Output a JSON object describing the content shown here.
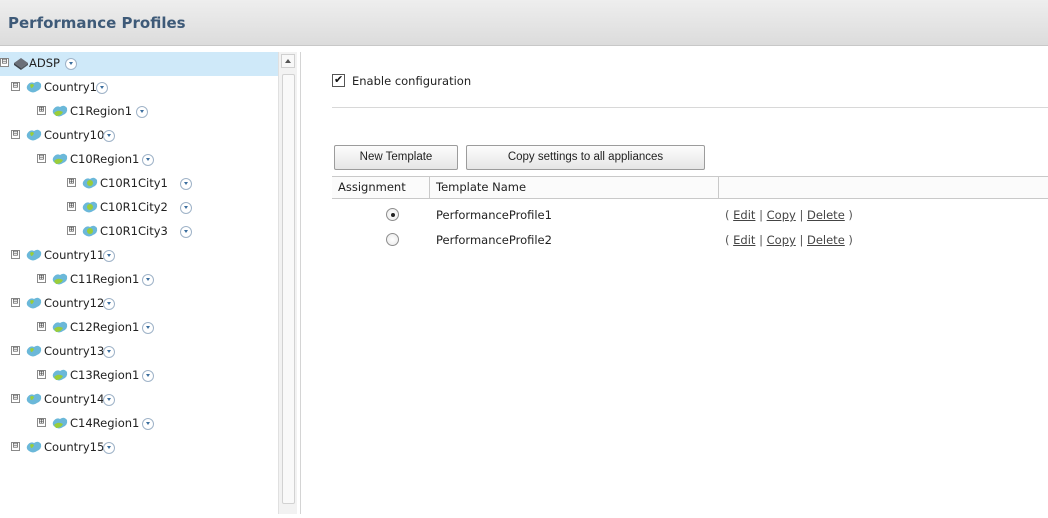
{
  "header": {
    "title": "Performance Profiles"
  },
  "tree": {
    "items": [
      {
        "label": "ADSP",
        "toggle": "⊟",
        "icon": "network-icon"
      },
      {
        "label": "Country1",
        "toggle": "⊟",
        "icon": "country-icon"
      },
      {
        "label": "C1Region1",
        "toggle": "⊞",
        "icon": "region-icon"
      },
      {
        "label": "Country10",
        "toggle": "⊟",
        "icon": "country-icon"
      },
      {
        "label": "C10Region1",
        "toggle": "⊟",
        "icon": "region-icon"
      },
      {
        "label": "C10R1City1",
        "toggle": "⊞",
        "icon": "city-icon"
      },
      {
        "label": "C10R1City2",
        "toggle": "⊞",
        "icon": "city-icon"
      },
      {
        "label": "C10R1City3",
        "toggle": "⊞",
        "icon": "city-icon"
      },
      {
        "label": "Country11",
        "toggle": "⊟",
        "icon": "country-icon"
      },
      {
        "label": "C11Region1",
        "toggle": "⊞",
        "icon": "region-icon"
      },
      {
        "label": "Country12",
        "toggle": "⊟",
        "icon": "country-icon"
      },
      {
        "label": "C12Region1",
        "toggle": "⊞",
        "icon": "region-icon"
      },
      {
        "label": "Country13",
        "toggle": "⊟",
        "icon": "country-icon"
      },
      {
        "label": "C13Region1",
        "toggle": "⊞",
        "icon": "region-icon"
      },
      {
        "label": "Country14",
        "toggle": "⊟",
        "icon": "country-icon"
      },
      {
        "label": "C14Region1",
        "toggle": "⊞",
        "icon": "region-icon"
      },
      {
        "label": "Country15",
        "toggle": "⊟",
        "icon": "country-icon"
      }
    ]
  },
  "config": {
    "enable_label": "Enable configuration",
    "enabled": true
  },
  "toolbar": {
    "new_template_label": "New Template",
    "copy_settings_label": "Copy settings to all appliances"
  },
  "table": {
    "headers": {
      "assignment": "Assignment",
      "template_name": "Template Name"
    },
    "rows": [
      {
        "selected": true,
        "name": "PerformanceProfile1",
        "edit": "Edit",
        "copy": "Copy",
        "delete": "Delete"
      },
      {
        "selected": false,
        "name": "PerformanceProfile2",
        "edit": "Edit",
        "copy": "Copy",
        "delete": "Delete"
      }
    ]
  },
  "colors": {
    "header_text": "#3e5a78",
    "selected_row": "#cfe9f9",
    "country_icon": "#6bb8d9",
    "region_icon_accent": "#9acd3a"
  }
}
